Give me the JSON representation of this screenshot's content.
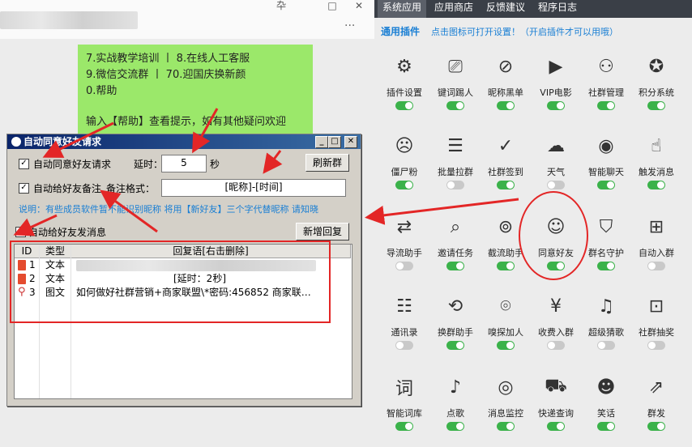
{
  "chat": {
    "window_controls": [
      "卆",
      "□",
      "✕"
    ],
    "more": "···",
    "bubble_lines": [
      "7.实战教学培训 丨 8.在线人工客服",
      "9.微信交流群  丨 70.迎国庆换新颜",
      "0.帮助",
      "",
      "输入【帮助】查看提示，如有其他疑问欢迎"
    ]
  },
  "panel": {
    "tabs": [
      "系统应用",
      "应用商店",
      "反馈建议",
      "程序日志"
    ],
    "active_tab": 0,
    "title": "通用插件",
    "subtitle": "点击图标可打开设置！（开启插件才可以用哦）",
    "plugins": [
      {
        "label": "插件设置",
        "icon": "gear-icon",
        "glyph": "⚙",
        "on": true
      },
      {
        "label": "键词踢人",
        "icon": "kick-icon",
        "glyph": "⎚",
        "on": true
      },
      {
        "label": "昵称黑单",
        "icon": "user-ban-icon",
        "glyph": "⊘",
        "on": true
      },
      {
        "label": "VIP电影",
        "icon": "play-icon",
        "glyph": "▶",
        "on": true
      },
      {
        "label": "社群管理",
        "icon": "group-settings-icon",
        "glyph": "⚇",
        "on": true
      },
      {
        "label": "积分系统",
        "icon": "medal-icon",
        "glyph": "✪",
        "on": true
      },
      {
        "label": "僵尸粉",
        "icon": "zombie-icon",
        "glyph": "☹",
        "on": true
      },
      {
        "label": "批量拉群",
        "icon": "chat-bubbles-icon",
        "glyph": "☰",
        "on": false
      },
      {
        "label": "社群签到",
        "icon": "calendar-check-icon",
        "glyph": "✓",
        "on": true
      },
      {
        "label": "天气",
        "icon": "weather-icon",
        "glyph": "☁",
        "on": false
      },
      {
        "label": "智能聊天",
        "icon": "robot-icon",
        "glyph": "◉",
        "on": true
      },
      {
        "label": "触发消息",
        "icon": "hand-touch-icon",
        "glyph": "☝",
        "on": true
      },
      {
        "label": "导流助手",
        "icon": "flow-icon",
        "glyph": "⇄",
        "on": false
      },
      {
        "label": "邀请任务",
        "icon": "invite-search-icon",
        "glyph": "⌕",
        "on": true
      },
      {
        "label": "截流助手",
        "icon": "bot-icon",
        "glyph": "⊚",
        "on": true
      },
      {
        "label": "同意好友",
        "icon": "smile-plus-icon",
        "glyph": "☺",
        "on": true
      },
      {
        "label": "群名守护",
        "icon": "shield-check-icon",
        "glyph": "⛉",
        "on": true
      },
      {
        "label": "自动入群",
        "icon": "add-chat-icon",
        "glyph": "⊞",
        "on": false
      },
      {
        "label": "通讯录",
        "icon": "contacts-icon",
        "glyph": "☷",
        "on": false
      },
      {
        "label": "换群助手",
        "icon": "swap-icon",
        "glyph": "⟲",
        "on": true
      },
      {
        "label": "嗅探加人",
        "icon": "antenna-icon",
        "glyph": "⌾",
        "on": true
      },
      {
        "label": "收费入群",
        "icon": "paid-chat-icon",
        "glyph": "¥",
        "on": false
      },
      {
        "label": "超级猜歌",
        "icon": "music-list-icon",
        "glyph": "♫",
        "on": false
      },
      {
        "label": "社群抽奖",
        "icon": "gift-icon",
        "glyph": "⊡",
        "on": false
      },
      {
        "label": "智能词库",
        "icon": "dictionary-icon",
        "glyph": "词",
        "on": true
      },
      {
        "label": "点歌",
        "icon": "music-note-icon",
        "glyph": "♪",
        "on": true
      },
      {
        "label": "消息监控",
        "icon": "eye-icon",
        "glyph": "◎",
        "on": true
      },
      {
        "label": "快递查询",
        "icon": "truck-icon",
        "glyph": "⛟",
        "on": true
      },
      {
        "label": "笑话",
        "icon": "laugh-icon",
        "glyph": "☻",
        "on": true
      },
      {
        "label": "群发",
        "icon": "share-icon",
        "glyph": "⇗",
        "on": true
      }
    ]
  },
  "dialog": {
    "title": "自动同意好友请求",
    "auto_accept_label": "自动同意好友请求",
    "delay_label": "延时：",
    "delay_value": "5",
    "delay_unit": "秒",
    "refresh_button": "刷新群",
    "auto_remark_label": "自动给好友备注",
    "remark_format_label": "备注格式：",
    "remark_format_value": "[昵称]-[时间]",
    "hint": "说明：有些成员软件暂不能识别昵称 将用【新好友】三个字代替昵称 请知晓",
    "auto_message_label": "自动给好友发消息",
    "add_reply_button": "新增回复",
    "table": {
      "headers": [
        "ID",
        "类型",
        "回复语[右击删除]"
      ],
      "rows": [
        {
          "id": "1",
          "type": "文本",
          "text": "",
          "icon": "doc-icon"
        },
        {
          "id": "2",
          "type": "文本",
          "text": "[延时：2秒]",
          "icon": "doc-icon"
        },
        {
          "id": "3",
          "type": "图文",
          "text": "如何做好社群营销+商家联盟\\*密码:456852 商家联…",
          "icon": "paperclip-icon"
        }
      ]
    }
  }
}
